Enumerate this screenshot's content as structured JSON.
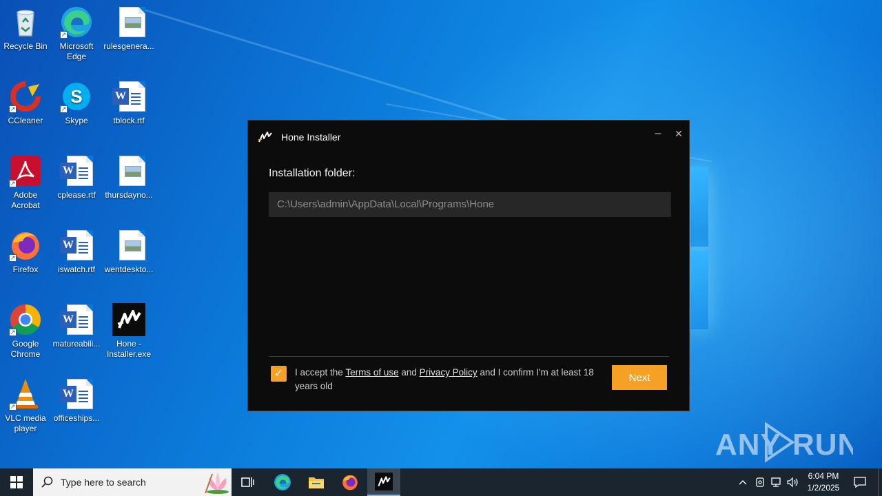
{
  "desktop": {
    "icons": [
      {
        "label": "Recycle Bin"
      },
      {
        "label": "Microsoft Edge"
      },
      {
        "label": "rulesgenera..."
      },
      {
        "label": "CCleaner"
      },
      {
        "label": "Skype"
      },
      {
        "label": "tblock.rtf"
      },
      {
        "label": "Adobe Acrobat"
      },
      {
        "label": "cplease.rtf"
      },
      {
        "label": "thursdayno..."
      },
      {
        "label": "Firefox"
      },
      {
        "label": "iswatch.rtf"
      },
      {
        "label": "wentdeskto..."
      },
      {
        "label": "Google Chrome"
      },
      {
        "label": "matureabili..."
      },
      {
        "label": "Hone - Installer.exe"
      },
      {
        "label": "VLC media player"
      },
      {
        "label": "officeships..."
      }
    ]
  },
  "installer": {
    "title": "Hone Installer",
    "minimize_glyph": "–",
    "close_glyph": "✕",
    "folder_label": "Installation folder:",
    "folder_path": "C:\\Users\\admin\\AppData\\Local\\Programs\\Hone",
    "accept_checked": true,
    "terms_prefix": "I accept the ",
    "terms_link": "Terms of use",
    "terms_mid": " and ",
    "privacy_link": "Privacy Policy",
    "terms_suffix": " and I confirm I'm at least 18 years old",
    "next_label": "Next",
    "accent_color": "#f6a126"
  },
  "watermark": {
    "text": "ANY RUN"
  },
  "taskbar": {
    "search_placeholder": "Type here to search",
    "time": "6:04 PM",
    "date": "1/2/2025"
  }
}
